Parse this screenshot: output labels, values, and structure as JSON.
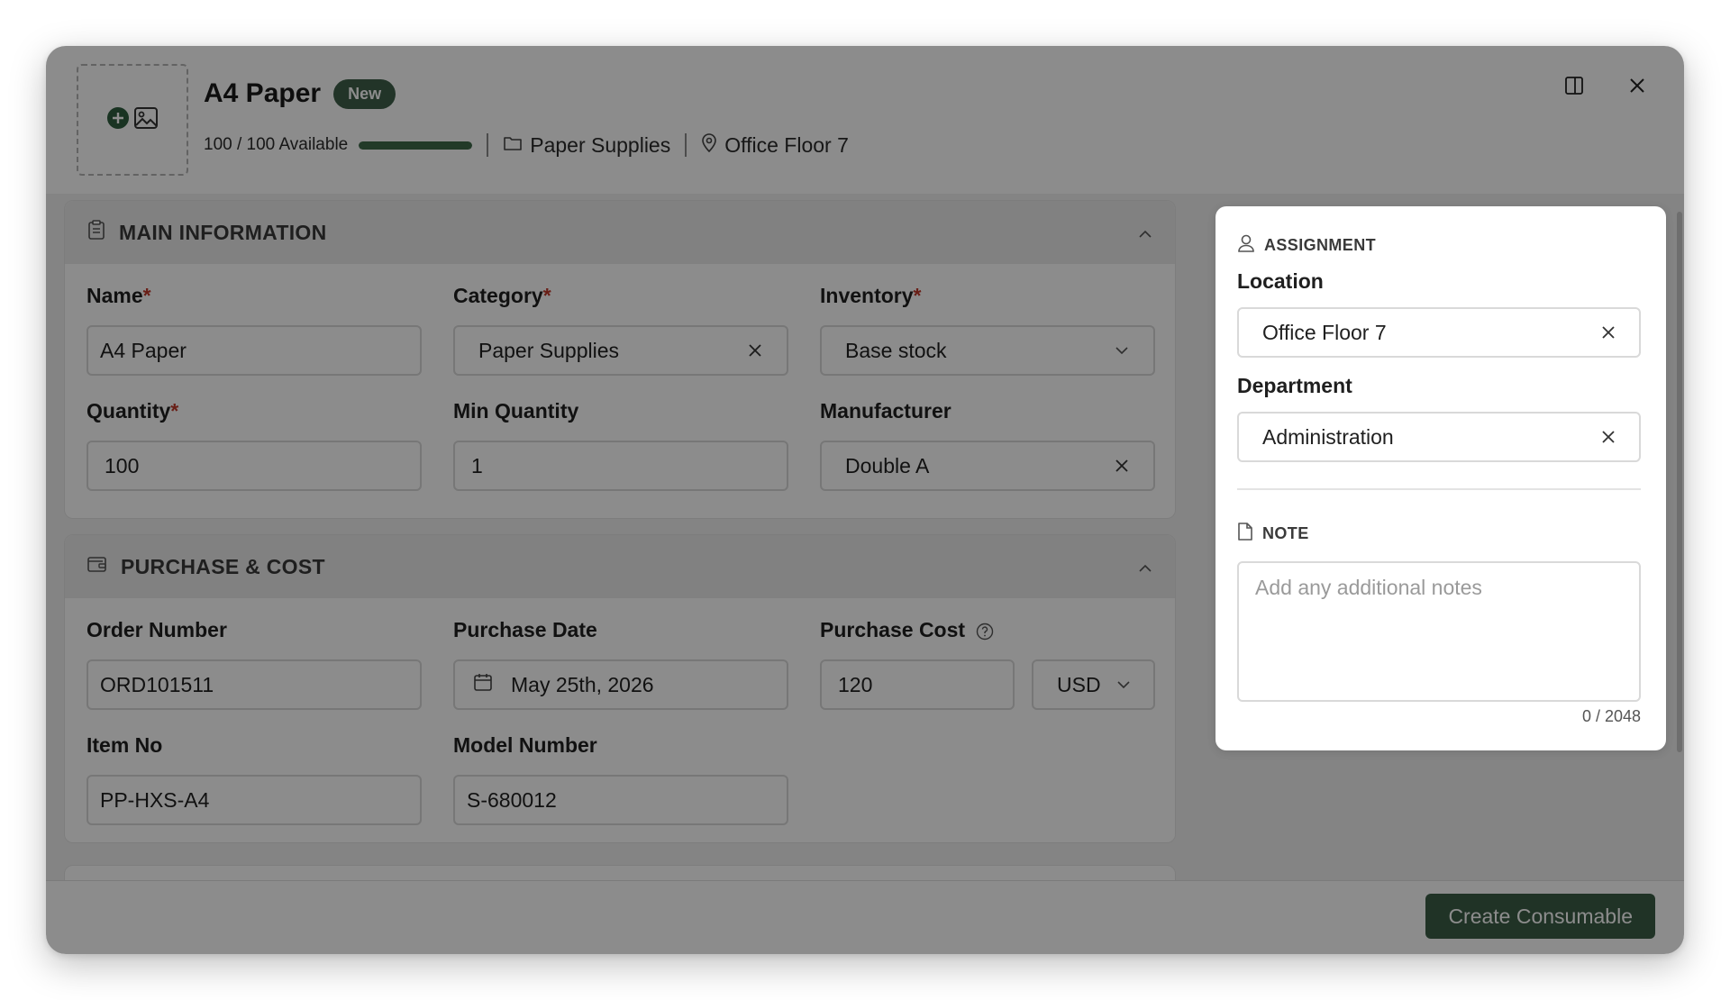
{
  "header": {
    "title": "A4 Paper",
    "badge": "New",
    "availability": "100 / 100 Available",
    "available_fraction": 1.0,
    "category": "Paper Supplies",
    "location": "Office Floor 7"
  },
  "sections": {
    "main": {
      "title": "MAIN INFORMATION",
      "name_label": "Name",
      "name_value": "A4 Paper",
      "category_label": "Category",
      "category_value": "Paper Supplies",
      "inventory_label": "Inventory",
      "inventory_value": "Base stock",
      "quantity_label": "Quantity",
      "quantity_value": "100",
      "min_quantity_label": "Min Quantity",
      "min_quantity_value": "1",
      "manufacturer_label": "Manufacturer",
      "manufacturer_value": "Double A",
      "required_mark": "*"
    },
    "purchase": {
      "title": "PURCHASE & COST",
      "order_number_label": "Order Number",
      "order_number_value": "ORD101511",
      "purchase_date_label": "Purchase Date",
      "purchase_date_value": "May 25th, 2026",
      "purchase_cost_label": "Purchase Cost",
      "purchase_cost_value": "120",
      "currency_value": "USD",
      "item_no_label": "Item No",
      "item_no_value": "PP-HXS-A4",
      "model_number_label": "Model Number",
      "model_number_value": "S-680012"
    }
  },
  "side_panel": {
    "assignment_title": "ASSIGNMENT",
    "location_label": "Location",
    "location_value": "Office Floor 7",
    "department_label": "Department",
    "department_value": "Administration",
    "note_title": "NOTE",
    "note_placeholder": "Add any additional notes",
    "note_counter": "0 / 2048"
  },
  "footer": {
    "create_label": "Create Consumable"
  },
  "colors": {
    "accent": "#3b5e46",
    "required": "#c0392b"
  }
}
